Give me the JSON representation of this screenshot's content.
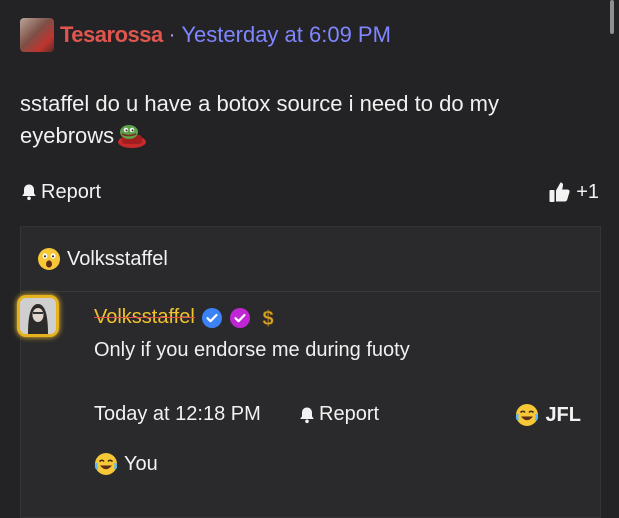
{
  "post": {
    "username": "Tesarossa",
    "separator": "·",
    "timestamp": "Yesterday at 6:09 PM",
    "body": "sstaffel do u have a botox source i need to do my eyebrows",
    "report_label": "Report",
    "reaction_count": "+1"
  },
  "quote": {
    "author": "Volksstaffel"
  },
  "reply": {
    "author": "Volksstaffel",
    "text": "Only if you endorse me during fuoty",
    "timestamp": "Today at 12:18 PM",
    "report_label": "Report",
    "reaction_label": "JFL",
    "reacted_by": "You"
  },
  "icons": {
    "bell": "bell-icon",
    "thumb": "thumbs-up-icon",
    "verified": "verified-badge-icon",
    "dollar": "dollar-icon",
    "emoji_shocked": "shocked-emoji-icon",
    "emoji_laugh": "laughing-crying-emoji-icon"
  },
  "colors": {
    "background": "#232325",
    "username": "#e0564f",
    "timestamp": "#7f86ff",
    "reply_name": "#f2c42c",
    "verified_blue": "#3b82f6",
    "verified_purple": "#c026d3"
  }
}
